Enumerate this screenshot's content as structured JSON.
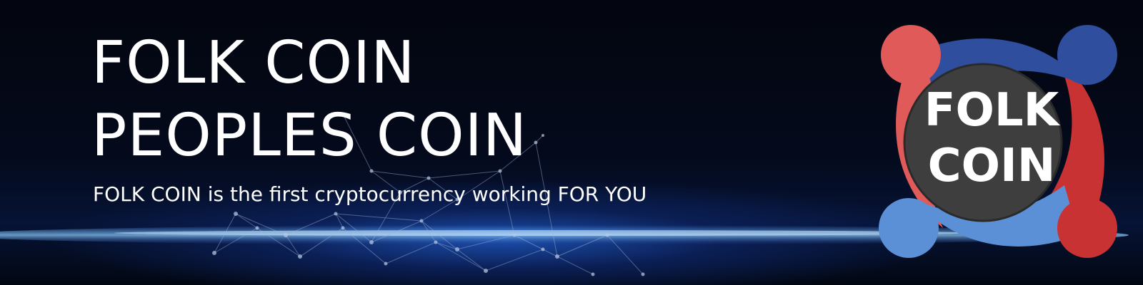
{
  "banner": {
    "title_line1": "FOLK COIN",
    "title_line2": "PEOPLES COIN",
    "tagline": "FOLK COIN is the first cryptocurrency working FOR YOU"
  },
  "logo": {
    "line1": "FOLK",
    "line2": "COIN",
    "colors": {
      "red": "#e05a5a",
      "blue": "#2f4f9e",
      "light_blue": "#5b8fd6",
      "dark_red": "#c83232",
      "center": "#3e3e3e"
    }
  }
}
